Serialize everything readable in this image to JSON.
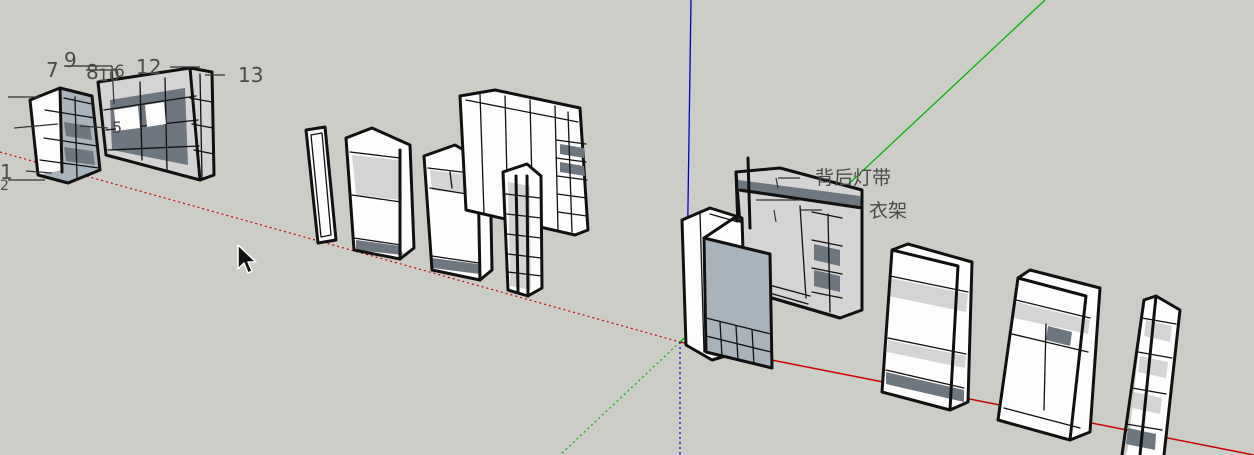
{
  "viewport": {
    "background_color": "#cdcdc8",
    "axes": {
      "red_color": "#c80000",
      "green_color": "#00b400",
      "blue_color": "#0000c8"
    },
    "labels": {
      "n7": "7",
      "n9": "9",
      "n8": "8",
      "n10": "10",
      "n6": "6",
      "n12": "12",
      "n13": "13",
      "n5": "5",
      "n1": "1",
      "n2": "2",
      "back_light_strip": "背后灯带",
      "hanger": "衣架"
    },
    "cursor_icon": "arrow-cursor-icon"
  }
}
